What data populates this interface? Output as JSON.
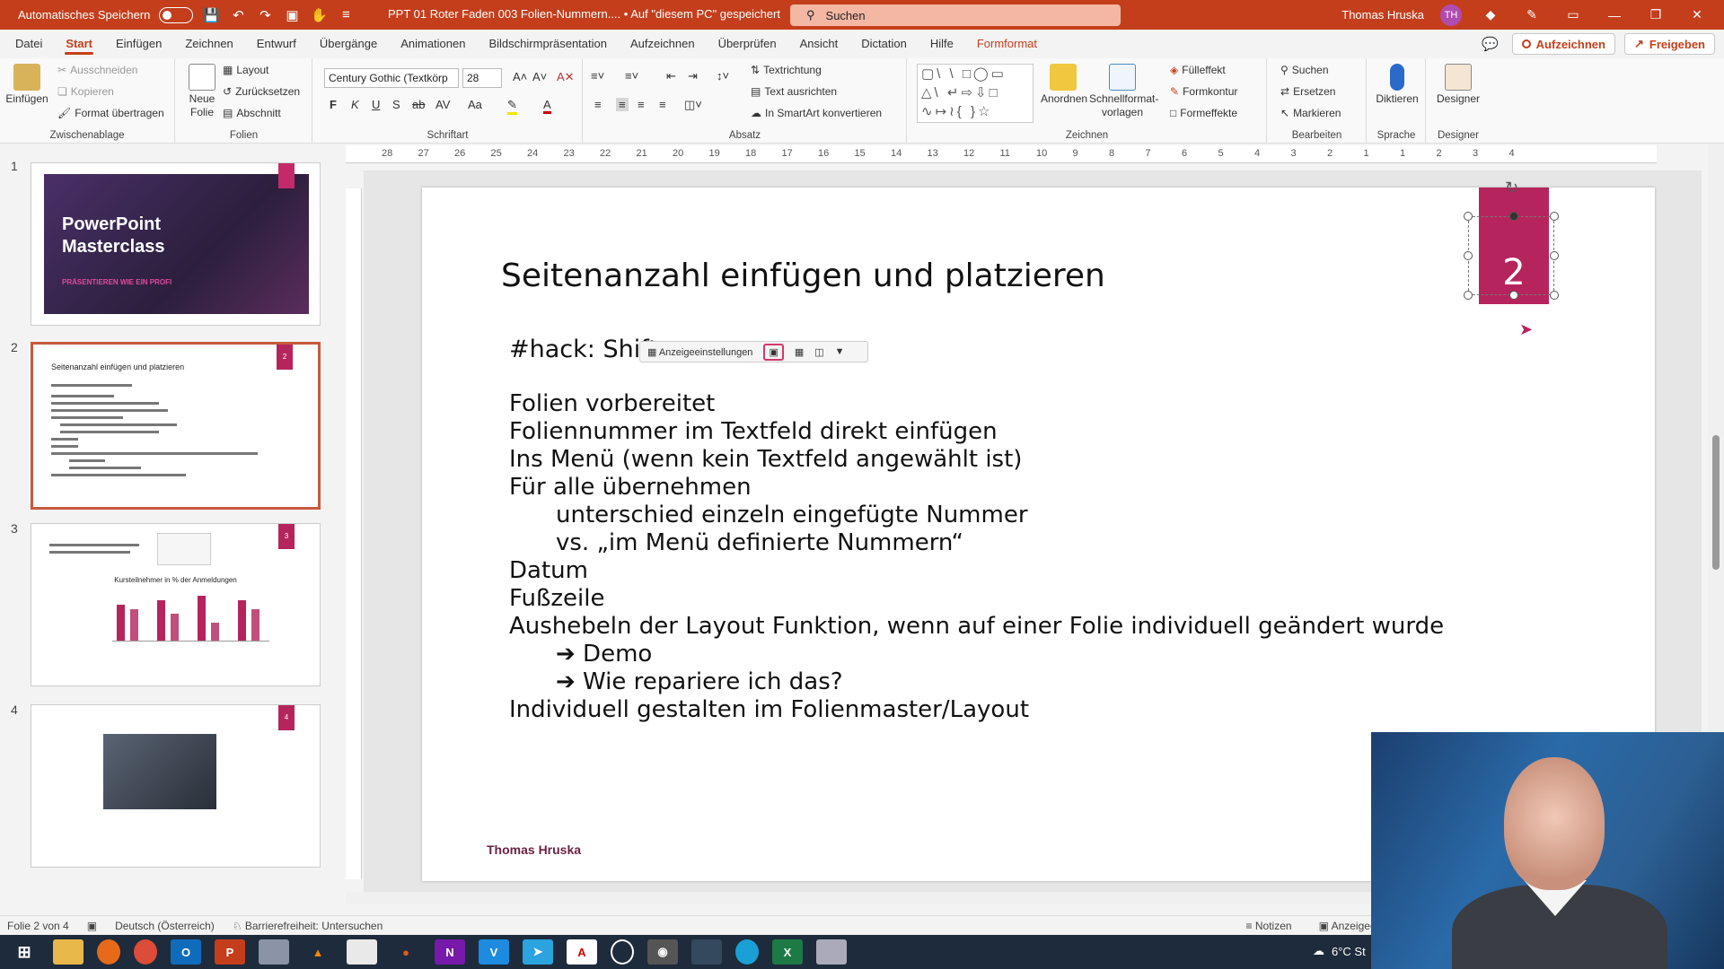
{
  "titlebar": {
    "autosave_label": "Automatisches Speichern",
    "doc_title": "PPT 01 Roter Faden 003 Folien-Nummern....  •  Auf \"diesem PC\" gespeichert",
    "search_placeholder": "Suchen",
    "user_name": "Thomas Hruska",
    "user_initials": "TH"
  },
  "menu": {
    "tabs": [
      "Datei",
      "Start",
      "Einfügen",
      "Zeichnen",
      "Entwurf",
      "Übergänge",
      "Animationen",
      "Bildschirmpräsentation",
      "Aufzeichnen",
      "Überprüfen",
      "Ansicht",
      "Dictation",
      "Hilfe",
      "Formformat"
    ],
    "record_button": "Aufzeichnen",
    "share_button": "Freigeben"
  },
  "ribbon": {
    "clipboard": {
      "label": "Zwischenablage",
      "paste": "Einfügen",
      "cut": "Ausschneiden",
      "copy": "Kopieren",
      "format_painter": "Format übertragen"
    },
    "slides": {
      "label": "Folien",
      "new_slide_1": "Neue",
      "new_slide_2": "Folie",
      "layout": "Layout",
      "reset": "Zurücksetzen",
      "section": "Abschnitt"
    },
    "font": {
      "label": "Schriftart",
      "family": "Century Gothic (Textkörp",
      "size": "28",
      "bold": "F",
      "italic": "K",
      "underline": "U",
      "shadow": "S",
      "strike": "ab"
    },
    "paragraph": {
      "label": "Absatz",
      "text_direction": "Textrichtung",
      "align_text": "Text ausrichten",
      "smartart": "In SmartArt konvertieren"
    },
    "drawing": {
      "label": "Zeichnen",
      "arrange": "Anordnen",
      "quickstyles_1": "Schnellformat-",
      "quickstyles_2": "vorlagen",
      "fill": "Fülleffekt",
      "outline": "Formkontur",
      "effects": "Formeffekte"
    },
    "editing": {
      "label": "Bearbeiten",
      "find": "Suchen",
      "replace": "Ersetzen",
      "select": "Markieren"
    },
    "voice": {
      "label": "Sprache",
      "dictate": "Diktieren"
    },
    "designer": {
      "label": "Designer",
      "button": "Designer"
    }
  },
  "ruler": {
    "ticks": [
      "28",
      "27",
      "26",
      "25",
      "24",
      "23",
      "22",
      "21",
      "20",
      "19",
      "18",
      "17",
      "16",
      "15",
      "14",
      "13",
      "12",
      "11",
      "10",
      "9",
      "8",
      "7",
      "6",
      "5",
      "4",
      "3",
      "2",
      "1",
      "1",
      "2",
      "3",
      "4"
    ]
  },
  "thumbnails": [
    {
      "num": "1",
      "title": "PowerPoint\nMasterclass",
      "subtitle": "PRÄSENTIEREN WIE EIN PROFI"
    },
    {
      "num": "2",
      "title": "Seitenanzahl einfügen und platzieren",
      "tag": "2"
    },
    {
      "num": "3",
      "title": "Kursteilnehmer in % der Anmeldungen",
      "tag": "3"
    },
    {
      "num": "4",
      "tag": "4"
    }
  ],
  "slide": {
    "title": "Seitenanzahl einfügen und platzieren",
    "hack": "#hack: Shift",
    "minitoolbar_label": "Anzeigeeinstellungen",
    "lines": [
      "Folien vorbereitet",
      "Foliennummer im Textfeld direkt einfügen",
      "Ins Menü (wenn kein Textfeld angewählt ist)",
      "Für alle übernehmen"
    ],
    "indented_1": [
      "unterschied  einzeln eingefügte Nummer",
      "vs. „im Menü definierte Nummern“"
    ],
    "lines_2": [
      "Datum",
      "Fußzeile",
      "Aushebeln der Layout Funktion, wenn auf einer Folie individuell geändert wurde"
    ],
    "indented_2": [
      "➔ Demo",
      "➔ Wie repariere ich das?"
    ],
    "last_line": "Individuell gestalten im Folienmaster/Layout",
    "footer": "Thomas Hruska",
    "slide_number": "2"
  },
  "status": {
    "slide_of": "Folie 2 von 4",
    "language": "Deutsch (Österreich)",
    "accessibility": "Barrierefreiheit: Untersuchen",
    "notes": "Notizen",
    "display": "Anzeigeeinstellunge"
  },
  "taskbar": {
    "weather": "6°C  St"
  },
  "colors": {
    "accent": "#c43e1c",
    "slide_magenta": "#b6245d"
  }
}
